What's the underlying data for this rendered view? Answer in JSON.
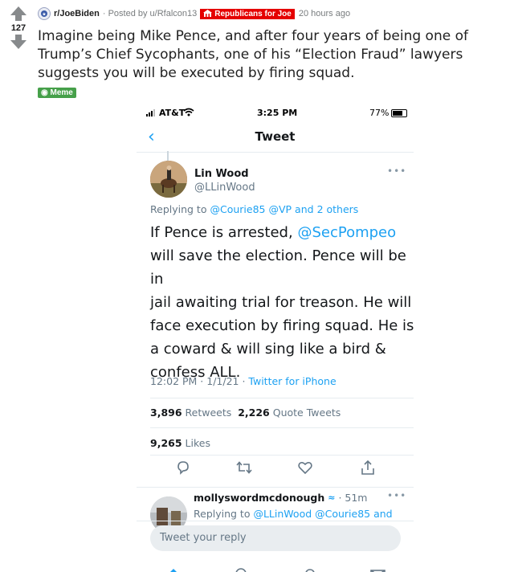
{
  "post": {
    "score": "127",
    "subreddit": "r/JoeBiden",
    "posted_by": "· Posted by u/Rfalcon13",
    "user_flair": "Republicans for Joe",
    "time_ago": "20 hours ago",
    "title": "Imagine being Mike Pence, and after four years of being one of Trump’s Chief Sycophants, one of his “Election Fraud” lawyers suggests you will be executed by firing squad.",
    "post_flair": "Meme"
  },
  "phone": {
    "carrier": "AT&T",
    "time": "3:25 PM",
    "battery": "77%",
    "battery_level": 0.77,
    "nav_title": "Tweet"
  },
  "tweet": {
    "name": "Lin Wood",
    "handle": "@LLinWood",
    "replying_prefix": "Replying to",
    "replying_user1": "@Courie85",
    "replying_user2": "@VP",
    "replying_and": "and",
    "replying_others": "2 others",
    "body_line1_prefix": "If Pence is arrested,",
    "body_mention": "@SecPompeo",
    "body_line2": "will save the election. Pence will be in",
    "body_line3": "jail awaiting trial for treason. He will",
    "body_line4": "face execution by firing squad. He is",
    "body_line5": "a coward & will sing like a bird &",
    "body_line6": "confess ALL.",
    "timestamp": "12:02 PM · 1/1/21 ·",
    "source": "Twitter for iPhone",
    "retweets_count": "3,896",
    "retweets_label": "Retweets",
    "quotes_count": "2,226",
    "quotes_label": "Quote Tweets",
    "likes_count": "9,265",
    "likes_label": "Likes"
  },
  "reply": {
    "name": "mollyswordmcdonough",
    "age": "· 51m",
    "replying_prefix": "Replying to",
    "users": "@LLinWood @Courie85 and"
  },
  "composer": {
    "placeholder": "Tweet your reply"
  },
  "icons": [
    "upvote-icon",
    "downvote-icon",
    "subreddit-icon",
    "flair-icon",
    "signal-icon",
    "wifi-icon",
    "battery-icon",
    "back-icon",
    "more-icon",
    "reply-icon",
    "retweet-icon",
    "like-icon",
    "share-icon",
    "home-icon",
    "search-icon",
    "notifications-icon",
    "messages-icon"
  ],
  "colors": {
    "twitter_blue": "#1da1f2",
    "flair_red": "#e50000",
    "flair_green": "#46a04a",
    "vote_gray": "#878a8c"
  }
}
